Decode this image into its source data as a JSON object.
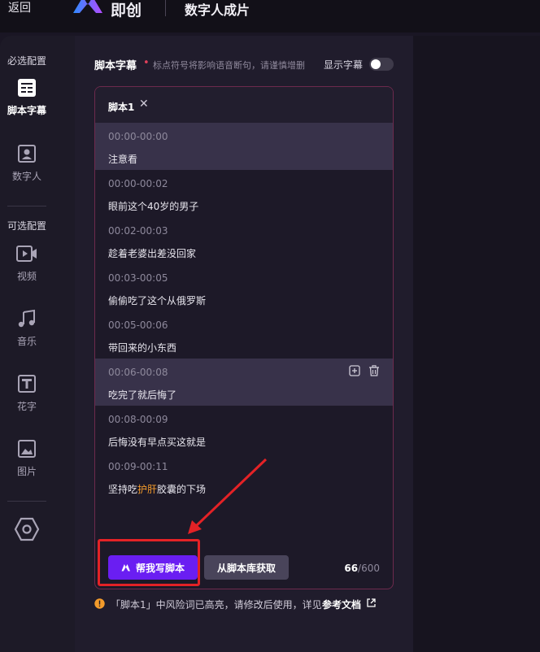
{
  "topbar": {
    "back_label": "返回",
    "logo_text": "即创",
    "app_title": "数字人成片"
  },
  "sidebar": {
    "required_label": "必选配置",
    "optional_label": "可选配置",
    "items": [
      {
        "label": "脚本字幕",
        "icon": "script-icon"
      },
      {
        "label": "数字人",
        "icon": "avatar-icon"
      },
      {
        "label": "视频",
        "icon": "video-icon"
      },
      {
        "label": "音乐",
        "icon": "music-icon"
      },
      {
        "label": "花字",
        "icon": "text-style-icon"
      },
      {
        "label": "图片",
        "icon": "image-icon"
      }
    ],
    "settings_icon": "hexagon-settings-icon"
  },
  "script_section": {
    "title": "脚本字幕",
    "required_mark": "•",
    "hint": "标点符号将影响语音断句，请谨慎增删",
    "show_subtitle_label": "显示字幕",
    "show_subtitle_on": false
  },
  "panel": {
    "tab_label": "脚本1",
    "tab_close": "✕",
    "rows": [
      {
        "time": "00:00-00:00",
        "text": "注意看"
      },
      {
        "time": "00:00-00:02",
        "text": "眼前这个40岁的男子"
      },
      {
        "time": "00:02-00:03",
        "text": "趁着老婆出差没回家"
      },
      {
        "time": "00:03-00:05",
        "text": "偷偷吃了这个从俄罗斯"
      },
      {
        "time": "00:05-00:06",
        "text": "带回来的小东西"
      },
      {
        "time": "00:06-00:08",
        "text": "吃完了就后悔了"
      },
      {
        "time": "00:08-00:09",
        "text": "后悔没有早点买这就是"
      },
      {
        "time": "00:09-00:11",
        "text_before": "坚持吃",
        "text_risk": "护肝",
        "text_after": "胶囊的下场"
      }
    ],
    "ai_write_label": "帮我写脚本",
    "library_label": "从脚本库获取",
    "count_current": "66",
    "count_max": "/600"
  },
  "warning": {
    "text": "「脚本1」中风险词已高亮，请修改后使用，详见",
    "link_label": "参考文档"
  },
  "colors": {
    "accent": "#6a1ef2",
    "risk_word": "#f39b2b",
    "annotation_red": "#e42226"
  }
}
